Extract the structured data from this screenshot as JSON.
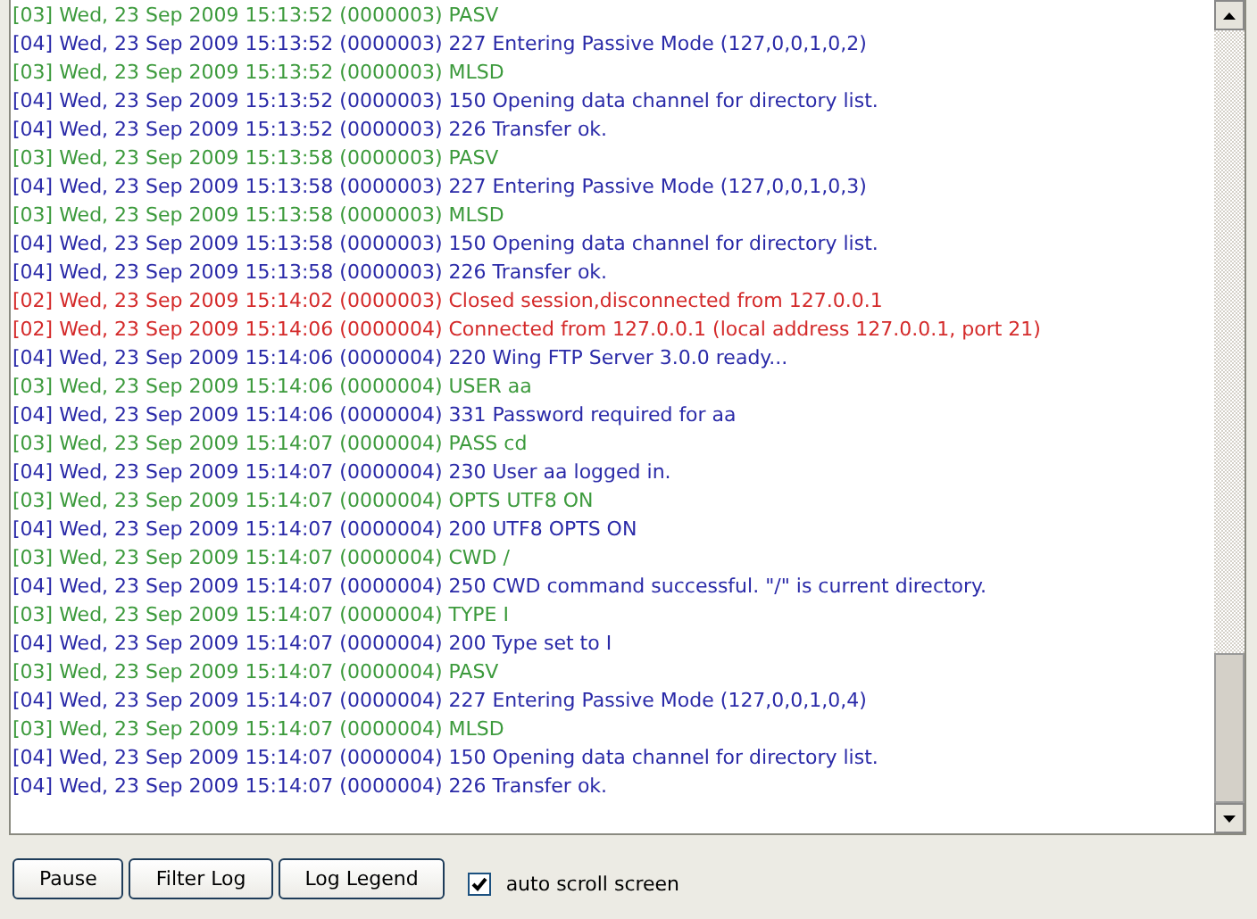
{
  "log": [
    {
      "text": "[03] Wed, 23 Sep 2009 15:13:52 (0000003) PASV",
      "color": "#3c9a3c"
    },
    {
      "text": "[04] Wed, 23 Sep 2009 15:13:52 (0000003) 227 Entering Passive Mode (127,0,0,1,0,2)",
      "color": "#2a2aa8"
    },
    {
      "text": "[03] Wed, 23 Sep 2009 15:13:52 (0000003) MLSD",
      "color": "#3c9a3c"
    },
    {
      "text": "[04] Wed, 23 Sep 2009 15:13:52 (0000003) 150 Opening data channel for directory list.",
      "color": "#2a2aa8"
    },
    {
      "text": "[04] Wed, 23 Sep 2009 15:13:52 (0000003) 226 Transfer ok.",
      "color": "#2a2aa8"
    },
    {
      "text": "[03] Wed, 23 Sep 2009 15:13:58 (0000003) PASV",
      "color": "#3c9a3c"
    },
    {
      "text": "[04] Wed, 23 Sep 2009 15:13:58 (0000003) 227 Entering Passive Mode (127,0,0,1,0,3)",
      "color": "#2a2aa8"
    },
    {
      "text": "[03] Wed, 23 Sep 2009 15:13:58 (0000003) MLSD",
      "color": "#3c9a3c"
    },
    {
      "text": "[04] Wed, 23 Sep 2009 15:13:58 (0000003) 150 Opening data channel for directory list.",
      "color": "#2a2aa8"
    },
    {
      "text": "[04] Wed, 23 Sep 2009 15:13:58 (0000003) 226 Transfer ok.",
      "color": "#2a2aa8"
    },
    {
      "text": "[02] Wed, 23 Sep 2009 15:14:02 (0000003) Closed session,disconnected from 127.0.0.1",
      "color": "#d42a2a"
    },
    {
      "text": "[02] Wed, 23 Sep 2009 15:14:06 (0000004) Connected from 127.0.0.1 (local address 127.0.0.1, port 21)",
      "color": "#d42a2a"
    },
    {
      "text": "[04] Wed, 23 Sep 2009 15:14:06 (0000004) 220 Wing FTP Server 3.0.0 ready...",
      "color": "#2a2aa8"
    },
    {
      "text": "[03] Wed, 23 Sep 2009 15:14:06 (0000004) USER aa",
      "color": "#3c9a3c"
    },
    {
      "text": "[04] Wed, 23 Sep 2009 15:14:06 (0000004) 331 Password required for aa",
      "color": "#2a2aa8"
    },
    {
      "text": "[03] Wed, 23 Sep 2009 15:14:07 (0000004) PASS cd",
      "color": "#3c9a3c"
    },
    {
      "text": "[04] Wed, 23 Sep 2009 15:14:07 (0000004) 230 User aa logged in.",
      "color": "#2a2aa8"
    },
    {
      "text": "[03] Wed, 23 Sep 2009 15:14:07 (0000004) OPTS UTF8 ON",
      "color": "#3c9a3c"
    },
    {
      "text": "[04] Wed, 23 Sep 2009 15:14:07 (0000004) 200 UTF8 OPTS ON",
      "color": "#2a2aa8"
    },
    {
      "text": "[03] Wed, 23 Sep 2009 15:14:07 (0000004) CWD /",
      "color": "#3c9a3c"
    },
    {
      "text": "[04] Wed, 23 Sep 2009 15:14:07 (0000004) 250 CWD command successful. \"/\" is current directory.",
      "color": "#2a2aa8"
    },
    {
      "text": "[03] Wed, 23 Sep 2009 15:14:07 (0000004) TYPE I",
      "color": "#3c9a3c"
    },
    {
      "text": "[04] Wed, 23 Sep 2009 15:14:07 (0000004) 200 Type set to I",
      "color": "#2a2aa8"
    },
    {
      "text": "[03] Wed, 23 Sep 2009 15:14:07 (0000004) PASV",
      "color": "#3c9a3c"
    },
    {
      "text": "[04] Wed, 23 Sep 2009 15:14:07 (0000004) 227 Entering Passive Mode (127,0,0,1,0,4)",
      "color": "#2a2aa8"
    },
    {
      "text": "[03] Wed, 23 Sep 2009 15:14:07 (0000004) MLSD",
      "color": "#3c9a3c"
    },
    {
      "text": "[04] Wed, 23 Sep 2009 15:14:07 (0000004) 150 Opening data channel for directory list.",
      "color": "#2a2aa8"
    },
    {
      "text": "[04] Wed, 23 Sep 2009 15:14:07 (0000004) 226 Transfer ok.",
      "color": "#2a2aa8"
    }
  ],
  "buttons": [
    "Pause",
    "Filter Log",
    "Log Legend"
  ],
  "auto_scroll": {
    "label": "auto scroll screen",
    "checked": true
  }
}
